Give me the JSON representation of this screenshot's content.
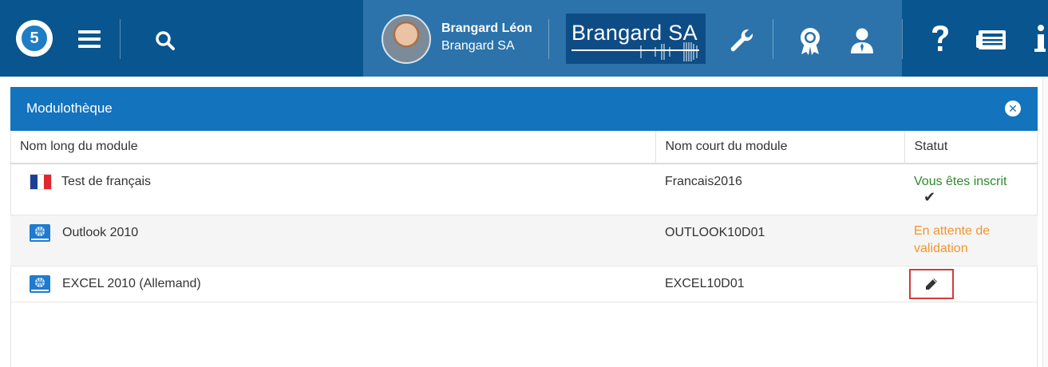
{
  "topbar": {
    "logo_text": "5",
    "user_name": "Brangard Léon",
    "user_company": "Brangard SA",
    "brand_name": "Brangard SA",
    "icons": [
      "menu-icon",
      "search-icon",
      "wrench-icon",
      "badge-icon",
      "user-icon",
      "help-icon",
      "news-icon",
      "info-icon"
    ],
    "colors": {
      "bar": "#08558f",
      "bar_mid": "#2b73aa",
      "brand_box": "#0e4c86"
    }
  },
  "panel": {
    "title": "Modulothèque",
    "header_color": "#1373bd"
  },
  "table": {
    "columns": [
      "Nom long du module",
      "Nom court du module",
      "Statut"
    ],
    "rows": [
      {
        "long_name": "Test de français",
        "short_name": "Francais2016",
        "status": "Vous êtes inscrit",
        "status_color": "#2c8a2c",
        "icon": "french-flag-icon",
        "status_icon": "check-icon"
      },
      {
        "long_name": "Outlook 2010",
        "short_name": "OUTLOOK10D01",
        "status": "En attente de validation",
        "status_color": "#f0962a",
        "icon": "web-module-icon"
      },
      {
        "long_name": "EXCEL 2010 (Allemand)",
        "short_name": "EXCEL10D01",
        "status": "",
        "icon": "web-module-icon",
        "status_icon": "pencil-icon"
      }
    ]
  }
}
